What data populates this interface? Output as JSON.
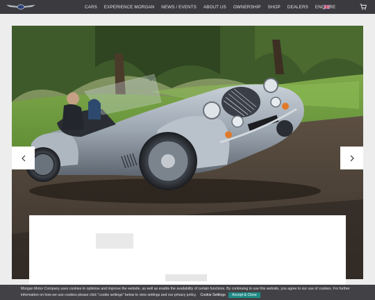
{
  "nav": {
    "logo_icon": "morgan-wings-logo-icon",
    "links": [
      "CARS",
      "EXPERIENCE MORGAN",
      "NEWS / EVENTS",
      "ABOUT US",
      "OWNERSHIP",
      "SHOP",
      "DEALERS",
      "ENQUIRE"
    ],
    "flag_icon": "uk-flag-icon",
    "cart_icon": "shopping-cart-icon"
  },
  "hero": {
    "image": "silver-morgan-roadster-driving-photo",
    "prev_icon": "chevron-left-icon",
    "next_icon": "chevron-right-icon"
  },
  "cookie": {
    "text_line1": "Morgan Motor Company uses cookies to optimise and improve the website, as well as enable the availability of certain functions. By continuing to use this website, you agree to our use of cookies. For further",
    "text_line2": "information on how we use cookies please click \"cookie settings\" below to view settings and our privacy policy.",
    "settings_label": "Cookie Settings",
    "accept_label": "Accept & Close",
    "accept_color": "#1f8a85"
  },
  "colors": {
    "nav_bg": "#3b3b3f",
    "page_bg": "#ededed"
  }
}
